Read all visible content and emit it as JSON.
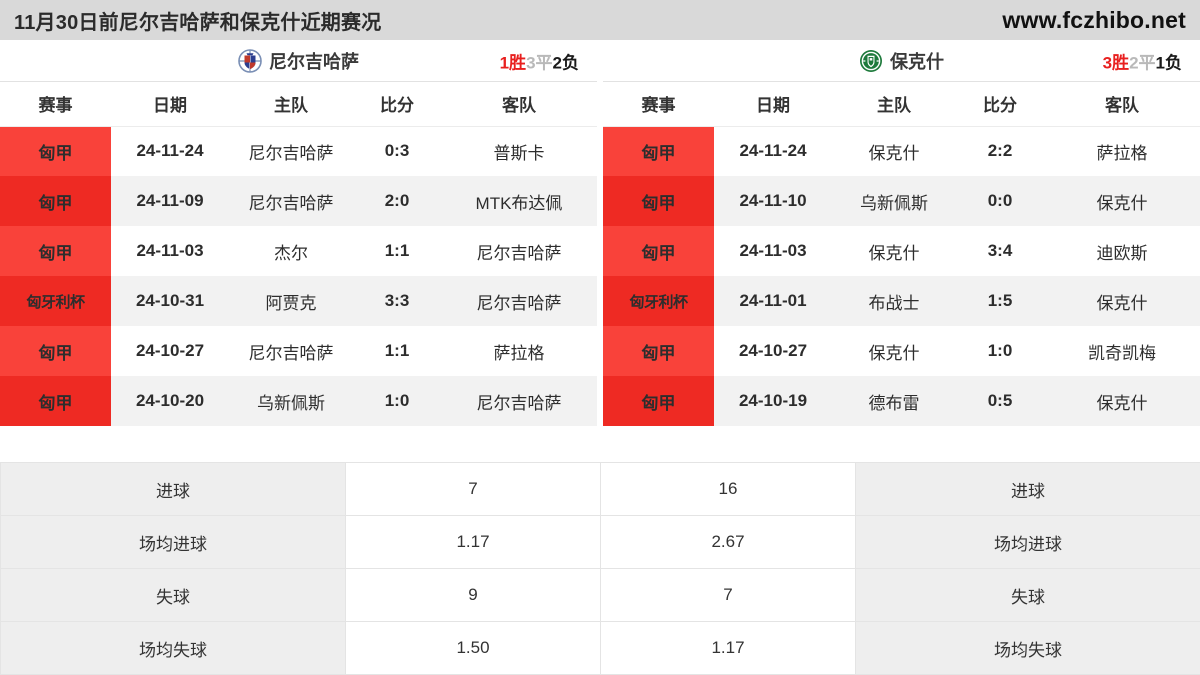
{
  "topbar": {
    "title": "11月30日前尼尔吉哈萨和保克什近期赛况",
    "site": "www.fczhibo.net"
  },
  "colors": {
    "accent_red": "#f9423a",
    "accent_red_alt": "#ee2a23",
    "topbar_bg": "#d9d9d9",
    "row_alt_bg": "#f2f2f2",
    "label_bg": "#eeeeee",
    "win": "#e8201f",
    "draw": "#b9b9b9",
    "loss": "#1a1a1a"
  },
  "left": {
    "team": "尼尔吉哈萨",
    "logo": "nyiregyhaza-crest-icon",
    "record": {
      "win": "1胜",
      "draw": "3平",
      "loss": "2负"
    },
    "columns": [
      "赛事",
      "日期",
      "主队",
      "比分",
      "客队"
    ],
    "matches": [
      {
        "comp": "匈甲",
        "date": "24-11-24",
        "home": "尼尔吉哈萨",
        "score": "0:3",
        "away": "普斯卡"
      },
      {
        "comp": "匈甲",
        "date": "24-11-09",
        "home": "尼尔吉哈萨",
        "score": "2:0",
        "away": "MTK布达佩"
      },
      {
        "comp": "匈甲",
        "date": "24-11-03",
        "home": "杰尔",
        "score": "1:1",
        "away": "尼尔吉哈萨"
      },
      {
        "comp": "匈牙利杯",
        "date": "24-10-31",
        "home": "阿贾克",
        "score": "3:3",
        "away": "尼尔吉哈萨"
      },
      {
        "comp": "匈甲",
        "date": "24-10-27",
        "home": "尼尔吉哈萨",
        "score": "1:1",
        "away": "萨拉格"
      },
      {
        "comp": "匈甲",
        "date": "24-10-20",
        "home": "乌新佩斯",
        "score": "1:0",
        "away": "尼尔吉哈萨"
      }
    ],
    "stats": [
      {
        "label": "进球",
        "value": "7"
      },
      {
        "label": "场均进球",
        "value": "1.17"
      },
      {
        "label": "失球",
        "value": "9"
      },
      {
        "label": "场均失球",
        "value": "1.50"
      }
    ]
  },
  "right": {
    "team": "保克什",
    "logo": "paksi-crest-icon",
    "record": {
      "win": "3胜",
      "draw": "2平",
      "loss": "1负"
    },
    "columns": [
      "赛事",
      "日期",
      "主队",
      "比分",
      "客队"
    ],
    "matches": [
      {
        "comp": "匈甲",
        "date": "24-11-24",
        "home": "保克什",
        "score": "2:2",
        "away": "萨拉格"
      },
      {
        "comp": "匈甲",
        "date": "24-11-10",
        "home": "乌新佩斯",
        "score": "0:0",
        "away": "保克什"
      },
      {
        "comp": "匈甲",
        "date": "24-11-03",
        "home": "保克什",
        "score": "3:4",
        "away": "迪欧斯"
      },
      {
        "comp": "匈牙利杯",
        "date": "24-11-01",
        "home": "布战士",
        "score": "1:5",
        "away": "保克什"
      },
      {
        "comp": "匈甲",
        "date": "24-10-27",
        "home": "保克什",
        "score": "1:0",
        "away": "凯奇凯梅"
      },
      {
        "comp": "匈甲",
        "date": "24-10-19",
        "home": "德布雷",
        "score": "0:5",
        "away": "保克什"
      }
    ],
    "stats": [
      {
        "label": "进球",
        "value": "16"
      },
      {
        "label": "场均进球",
        "value": "2.67"
      },
      {
        "label": "失球",
        "value": "7"
      },
      {
        "label": "场均失球",
        "value": "1.17"
      }
    ]
  }
}
